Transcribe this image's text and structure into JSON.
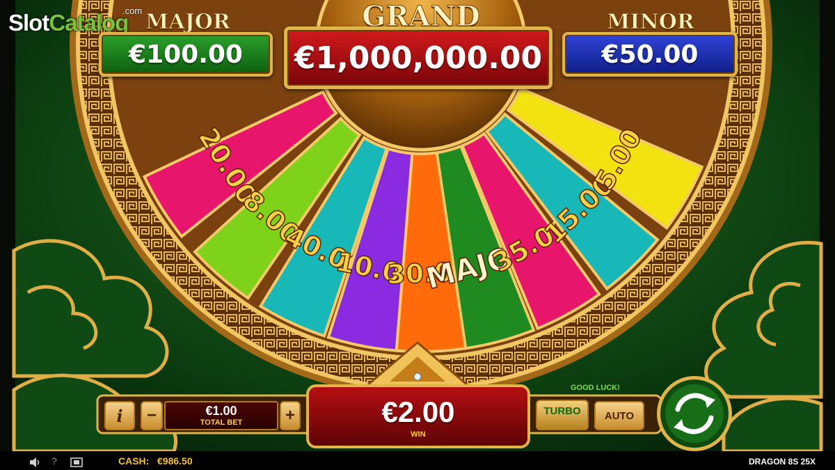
{
  "watermark": {
    "brand_a": "Slot",
    "brand_b": "Catalog",
    "suffix": ".com"
  },
  "jackpots": {
    "grand": {
      "title": "GRAND",
      "value": "€1,000,000.00"
    },
    "major": {
      "title": "MAJOR",
      "value": "€100.00"
    },
    "minor": {
      "title": "MINOR",
      "value": "€50.00"
    }
  },
  "wheel": {
    "segments": [
      {
        "label": "20.00",
        "color": "#e8156c"
      },
      {
        "label": "8.00",
        "color": "#7fd21a"
      },
      {
        "label": "40.00",
        "color": "#18b8b8"
      },
      {
        "label": "10.00",
        "color": "#8a2be2"
      },
      {
        "label": "30.00",
        "color": "#ff6a0a"
      },
      {
        "label": "MAJOR",
        "color": "#1f8a1f"
      },
      {
        "label": "35.00",
        "color": "#e8156c"
      },
      {
        "label": "15.00",
        "color": "#18b8b8"
      },
      {
        "label": "5.00",
        "color": "#f2e20f"
      }
    ]
  },
  "controls": {
    "info_label": "i",
    "minus_label": "−",
    "plus_label": "+",
    "total_bet_value": "€1.00",
    "total_bet_label": "TOTAL BET",
    "win_value": "€2.00",
    "win_label": "WIN",
    "good_luck": "GOOD LUCK!",
    "turbo_label": "TURBO",
    "auto_label": "AUTO"
  },
  "status_bar": {
    "cash_label": "CASH:",
    "cash_value": "€986.50",
    "help_label": "?",
    "game_name": "DRAGON 8S 25X"
  },
  "colors": {
    "gold": "#e2b44c",
    "dark_green": "#0e3a12",
    "grand_red": "#b00c10",
    "major_green": "#1b7a1b",
    "minor_blue": "#1a2ca8",
    "win_red": "#8c0a0a"
  }
}
